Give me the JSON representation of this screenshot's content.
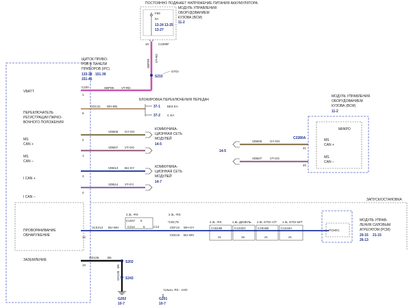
{
  "top_module": {
    "title": "ПОСТОЯННО ПОДАЧАЕТ НАПРЯЖЕНИЕ ПИТАНИЯ АККУМУЛЯТОРА",
    "subtitle_1": "МОДУЛЬ УПРАВЛЕНИЯ",
    "subtitle_2": "ОБОРУДОВАНИЕМ",
    "subtitle_3": "КУЗОВА (BCM)",
    "ref": "11-2",
    "fuse_name": "F69",
    "fuse_rating": "5A",
    "fuse_ref_1": "13-24",
    "fuse_ref_2": "13-25",
    "fuse_ref_3": "13-27",
    "connector": "C2280F",
    "pin": "16"
  },
  "vertical_wire": {
    "circuit": "SBP09",
    "color": "VT-RD",
    "splice": "S215",
    "splice_label": "GTDI"
  },
  "ipc_header": {
    "line1": "ЩИТОК ПРИБО-",
    "line2": "РОВ В ПАНЕЛИ",
    "line3": "ПРИБОРОВ (IPC)",
    "ref1": "133-38",
    "ref2": "151-39",
    "ref3": "151-41"
  },
  "left_labels": {
    "vbatt": "VBATT",
    "park1": "ПЕРЕКЛЮЧАТЕЛЬ",
    "park2": "РЕГИСТРАЦИИ ПАРКО-",
    "park3": "ВОЧНОГО ПОЛОЖЕНИЯ",
    "ms_plus_1": "MS",
    "ms_plus_2": "CAN +",
    "ms_minus_1": "MS",
    "ms_minus_2": "CAN –",
    "ican_plus": "I CAN +",
    "ican_minus": "I CAN –",
    "gap1": "ПРОВОРАЧИВАНИЕ",
    "gap2": "ОБНАРУЖЕНИЕ",
    "ground": "ЗАЗЕМЛЕНИЕ"
  },
  "connector_c220": "C220",
  "wire_vbatt": {
    "circuit": "SBP09",
    "color": "VT-RD",
    "pin": "1"
  },
  "wire_park": {
    "circuit": "CDC41",
    "color": "WH-BN",
    "pin": "9"
  },
  "park_block": {
    "title": "БЛОКИРОВКА ПЕРЕКЛЮЧЕНИЯ ПЕРЕДАЧ",
    "ref1": "37-1",
    "label1": "БЕЗ ЕА",
    "ref2": "37-2",
    "label2": "С ЕА"
  },
  "wire_ms1": {
    "circuit": "VDB06",
    "color": "GY-OG",
    "pin": "2"
  },
  "wire_ms2": {
    "circuit": "VDB07",
    "color": "VT-OG",
    "pin": "1"
  },
  "ms_net": {
    "l1": "КОММУНИКА-",
    "l2": "ЦИОННАЯ СЕТЬ",
    "l3": "МОДУЛЕЙ",
    "ref": "14-5"
  },
  "wire_ic1": {
    "circuit": "VDB13",
    "color": "BU-GY",
    "pin": "3"
  },
  "wire_ic2": {
    "circuit": "VDB14",
    "color": "VT-GY",
    "pin": "4"
  },
  "ic_net": {
    "l1": "КОММУНИКА-",
    "l2": "ЦИОННАЯ СЕТЬ",
    "l3": "МОДУЛЕЙ",
    "ref": "14-7"
  },
  "right_net_ref": "14-5",
  "right_wire1": {
    "circuit": "VDB06",
    "color": "GY-OG",
    "connector": "C2280A",
    "pin": "41"
  },
  "right_wire2": {
    "circuit": "VDB07",
    "color": "VT-OG",
    "pin": "40"
  },
  "bcm_right": {
    "l1": "МОДУЛЬ УПРАВЛЕНИЯ",
    "l2": "ОБОРУДОВАНИЕМ",
    "l3": "КУЗОВА (BCM)",
    "ref": "11-2",
    "micro": "МИКРО",
    "ms_plus_1": "MS",
    "ms_plus_2": "CAN +",
    "ms_minus_1": "MS",
    "ms_minus_2": "CAN –"
  },
  "start_label": "ЗАПУСК/ОСТАНОВКА",
  "crank_wire": {
    "c1": "VLE213",
    "col1": "BU-WH",
    "c2": "CEF13",
    "col2": "WH-GY",
    "c3": "CEE15",
    "col3": "BU-WH",
    "pin": "12"
  },
  "crank_conns": {
    "eng1": "2.3L -RS",
    "c1047": "C1047",
    "c1047p": "5",
    "c214": "C214",
    "c214p": "5",
    "eng2": "2.3L -RS",
    "c179": "*C9C79",
    "c131": "C13",
    "eng3": "2.3L -RS",
    "c1524": "C1524B",
    "c1524p": "21",
    "eng4": "1.6L ДИЗЕЛЬ",
    "c1232": "C1232G",
    "c1232p": "16",
    "eng5": "2.0L GTDI А/Т",
    "c1915": "C1915B",
    "c1915p": "21",
    "eng6": "1.0L GTDI M/T",
    "c1215": "C1215A",
    "c1215p": "21"
  },
  "pcm": {
    "box": "PCM/IC",
    "l1": "МОДУЛЬ УПРАВ-",
    "l2": "ЛЕНИЯ СИЛОВЫМ",
    "l3": "АГРЕГАТОМ (PCM)",
    "ref1": "20-15",
    "ref2": "21-15",
    "ref3": "26-13"
  },
  "ground": {
    "circuit": "GD136",
    "color": "BK",
    "pin": "10",
    "s202": "S202",
    "vcircuit": "GD136",
    "vcolor": "BK",
    "s243": "S243",
    "g202": "G202",
    "g202r": "10-7",
    "note": "только, RS - LHD",
    "g201": "G201",
    "g201r": "10-7"
  },
  "colors": {
    "violet_red": "#c855a8",
    "white_brown": "#a07850",
    "grey_orange": "#8a7a55",
    "violet_orange": "#9a6a8a",
    "blue_grey": "#3a4aa8",
    "ink_blue": "#1f2f8f",
    "black": "#111111"
  }
}
